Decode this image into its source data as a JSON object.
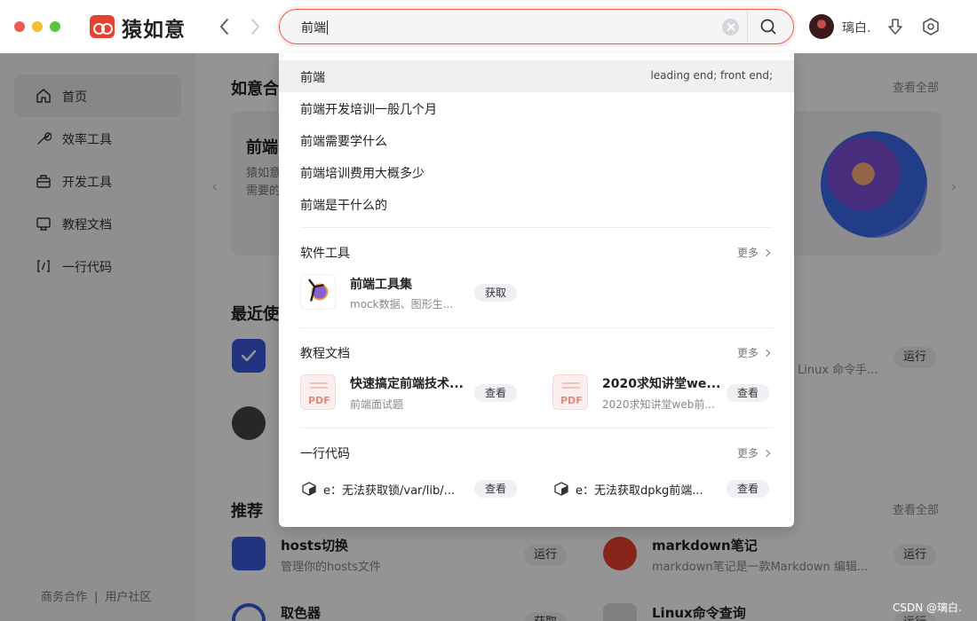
{
  "app": {
    "name": "猿如意"
  },
  "search": {
    "query": "前端"
  },
  "user": {
    "name": "璃白."
  },
  "colors": {
    "brand": "#e8412f",
    "accent": "#e46050"
  },
  "sidebar": {
    "items": [
      {
        "label": "首页",
        "icon": "home-icon",
        "active": true
      },
      {
        "label": "效率工具",
        "icon": "wrench-icon"
      },
      {
        "label": "开发工具",
        "icon": "toolbox-icon"
      },
      {
        "label": "教程文档",
        "icon": "monitor-icon"
      },
      {
        "label": "一行代码",
        "icon": "code-bracket-icon"
      }
    ],
    "footer": {
      "business": "商务合作",
      "separator": "|",
      "community": "用户社区"
    }
  },
  "main": {
    "section1": "如意合",
    "view_all": "查看全部",
    "banner_title": "前端",
    "banner_desc_1": "猿如意",
    "banner_desc_2": "需要的",
    "recent": "最近使",
    "recommend": "推荐",
    "recommend_view_all": "查看全部",
    "linux_desc": "Linux 命令手...",
    "run": "运行",
    "tools": [
      {
        "name": "hosts切换",
        "desc": "管理你的hosts文件",
        "run": "运行"
      },
      {
        "name": "markdown笔记",
        "desc": "markdown笔记是一款Markdown 编辑...",
        "run": "运行"
      },
      {
        "name": "取色器",
        "run": "获取"
      },
      {
        "name": "Linux命令查询",
        "run": "运行"
      }
    ]
  },
  "dropdown": {
    "suggestions": [
      {
        "text": "前端",
        "translation": "leading end; front end;"
      },
      {
        "text": "前端开发培训一般几个月"
      },
      {
        "text": "前端需要学什么"
      },
      {
        "text": "前端培训费用大概多少"
      },
      {
        "text": "前端是干什么的"
      }
    ],
    "software": {
      "title": "软件工具",
      "more": "更多",
      "item": {
        "name": "前端工具集",
        "desc": "mock数据、图形生...",
        "action": "获取"
      }
    },
    "docs": {
      "title": "教程文档",
      "more": "更多",
      "items": [
        {
          "name": "快速搞定前端技术...",
          "desc": "前端面试题",
          "action": "查看",
          "badge": "PDF"
        },
        {
          "name": "2020求知讲堂we...",
          "desc": "2020求知讲堂web前...",
          "action": "查看",
          "badge": "PDF"
        }
      ]
    },
    "code": {
      "title": "一行代码",
      "more": "更多",
      "items": [
        {
          "text": "e：无法获取锁/var/lib/...",
          "action": "查看"
        },
        {
          "text": "e：无法获取dpkg前端...",
          "action": "查看"
        }
      ]
    }
  },
  "watermark": "CSDN @璃白."
}
